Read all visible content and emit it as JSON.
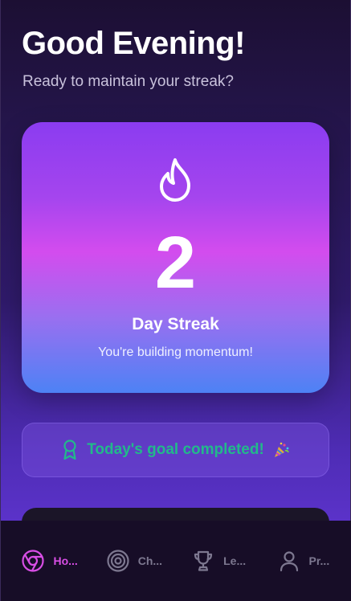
{
  "header": {
    "greeting": "Good Evening!",
    "subtitle": "Ready to maintain your streak?"
  },
  "streak": {
    "count": "2",
    "label": "Day Streak",
    "message": "You're building momentum!",
    "icon": "flame-icon"
  },
  "goal": {
    "text": "Today's goal completed!",
    "icon": "award-icon",
    "emoji_icon": "party-popper-icon",
    "color": "#22b98a"
  },
  "nav": {
    "items": [
      {
        "label": "Ho...",
        "icon": "chrome-icon",
        "active": true
      },
      {
        "label": "Ch...",
        "icon": "target-icon",
        "active": false
      },
      {
        "label": "Le...",
        "icon": "trophy-icon",
        "active": false
      },
      {
        "label": "Pr...",
        "icon": "user-icon",
        "active": false
      }
    ],
    "active_color": "#d94ee6",
    "inactive_color": "#7d7890"
  }
}
